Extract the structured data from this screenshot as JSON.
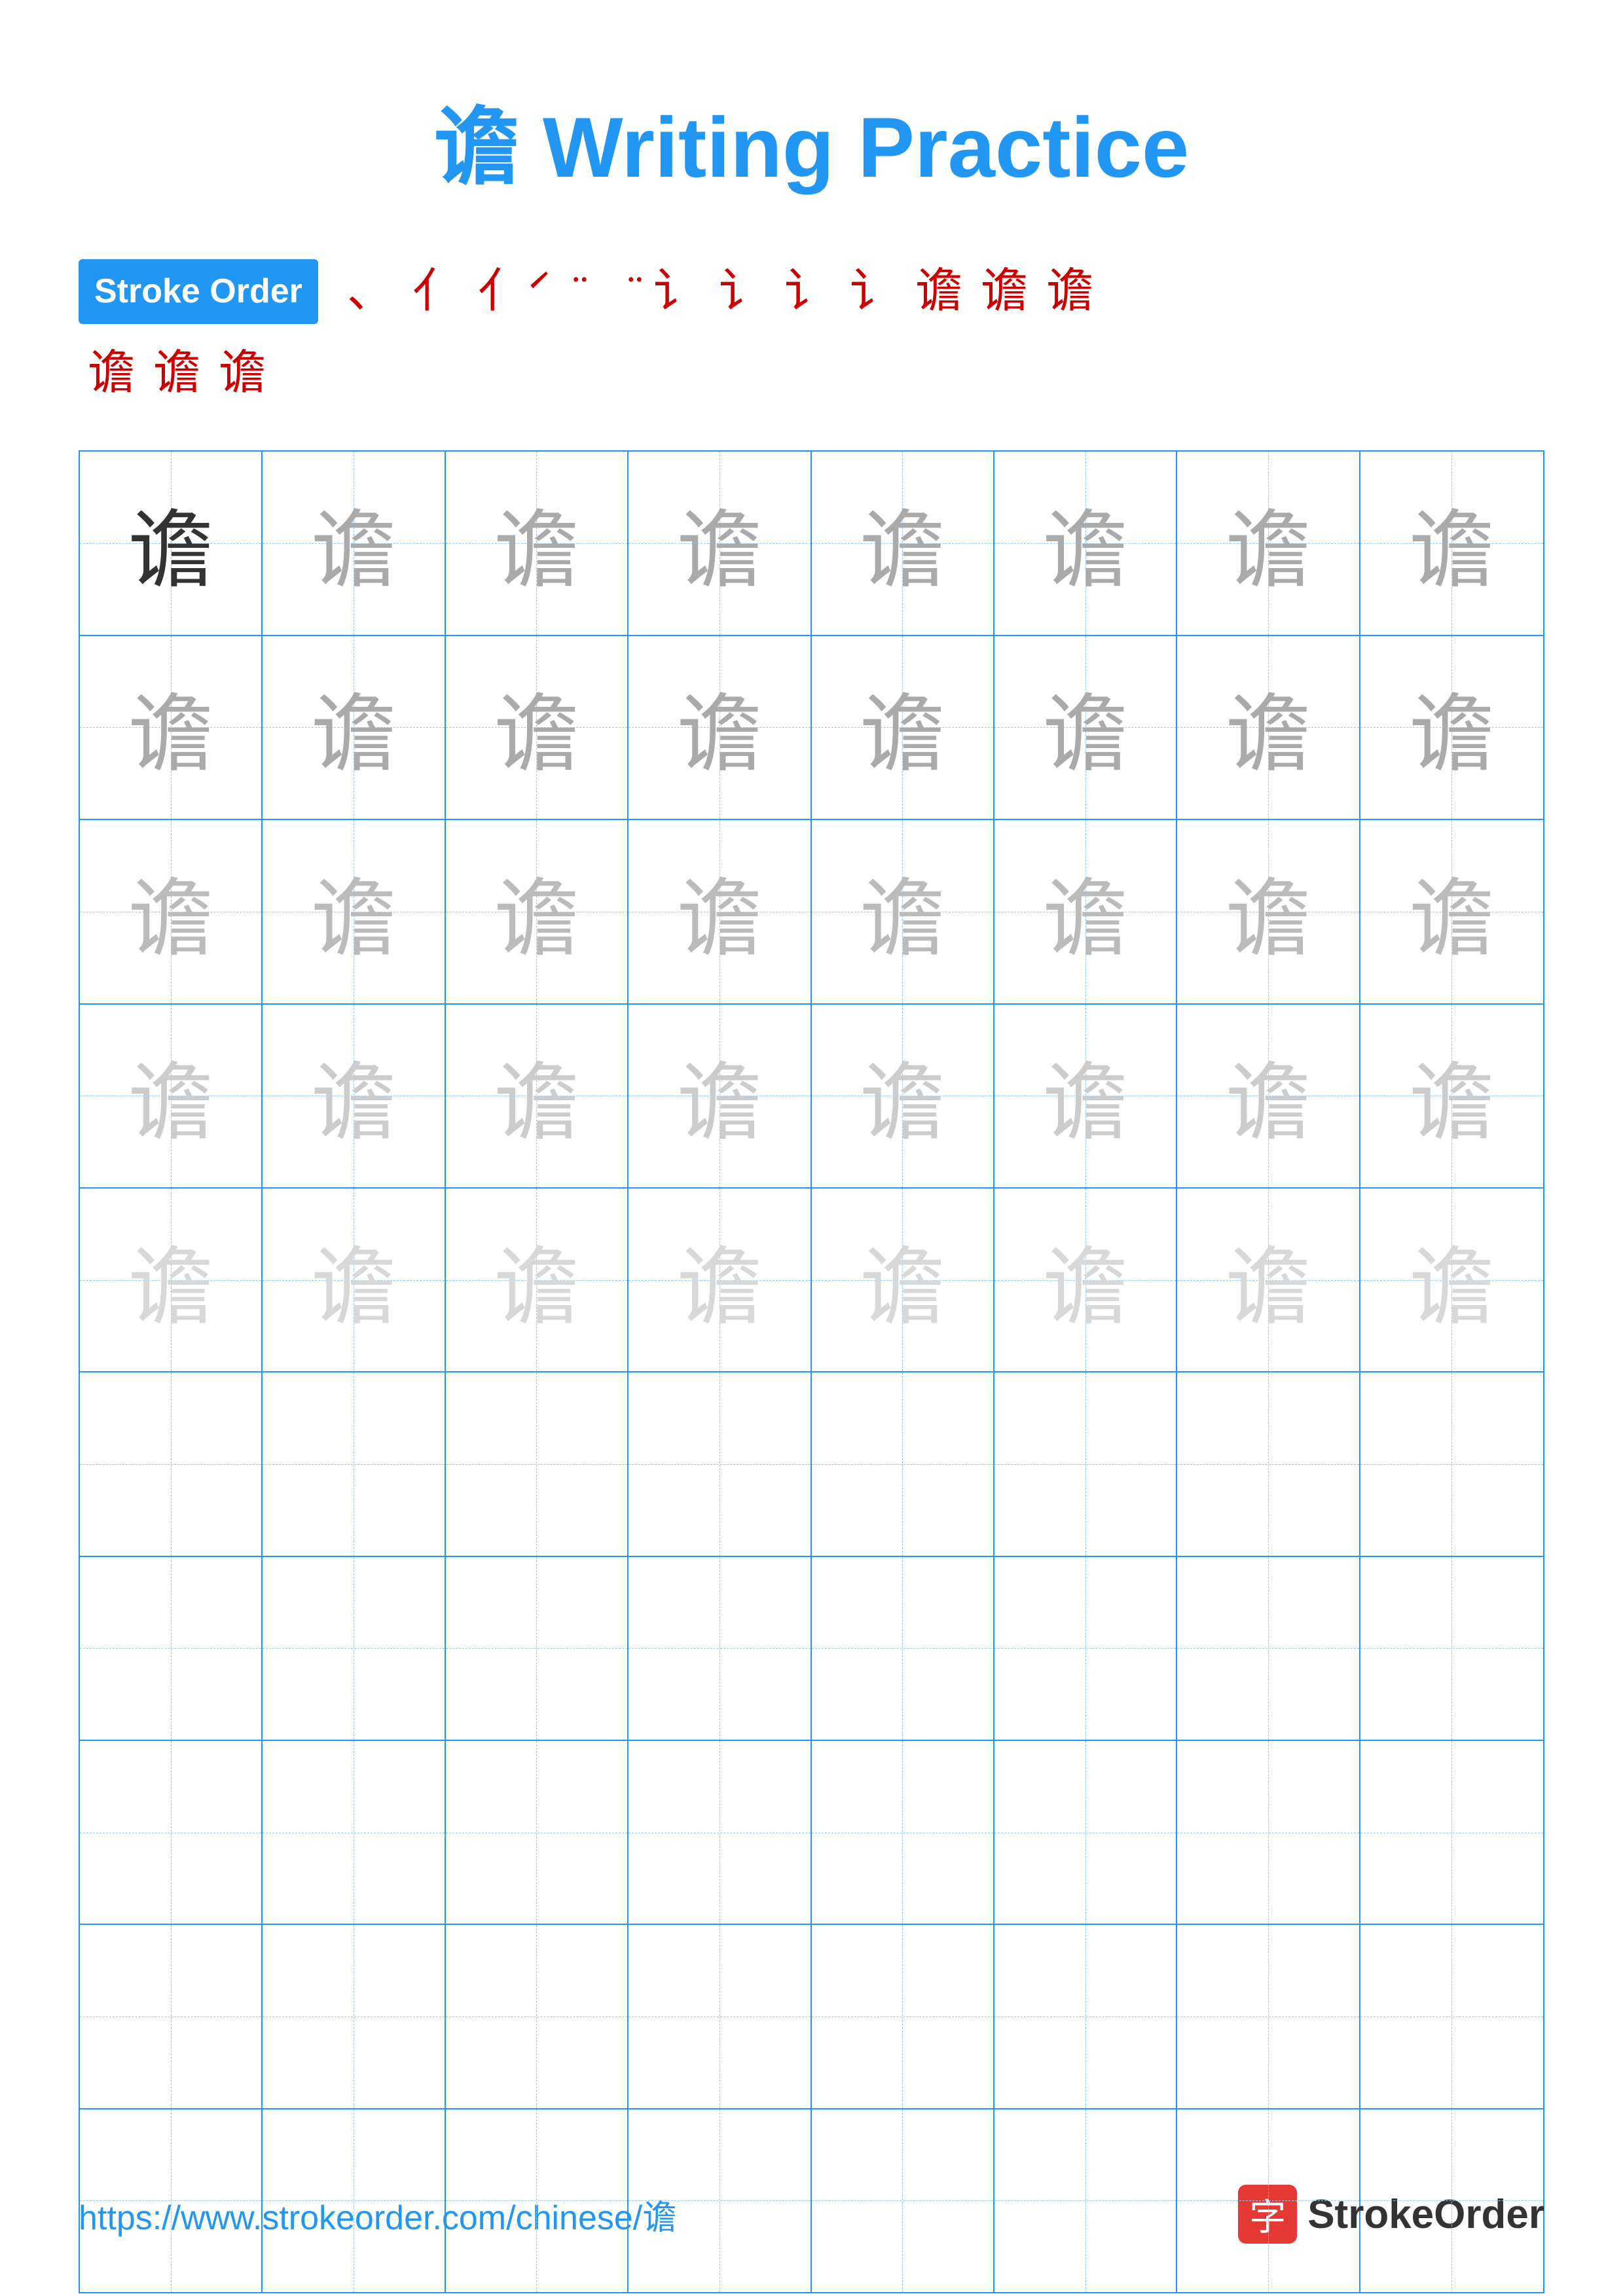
{
  "title": "谵 Writing Practice",
  "stroke_order": {
    "badge": "Stroke Order",
    "strokes_row1": [
      "` ",
      "亻",
      "亻",
      "亻",
      "亻",
      "讠",
      "讠",
      "讠",
      "讠",
      "谵",
      "谵",
      "谵"
    ],
    "strokes_row2": [
      "谵",
      "谵",
      "谵"
    ]
  },
  "character": "谵",
  "grid": {
    "rows": 10,
    "cols": 8,
    "filled_rows": 5,
    "opacities": [
      "dark",
      "medium",
      "light1",
      "light2",
      "light3"
    ]
  },
  "footer": {
    "url": "https://www.strokeorder.com/chinese/谵",
    "logo_char": "字",
    "logo_name": "StrokeOrder"
  }
}
